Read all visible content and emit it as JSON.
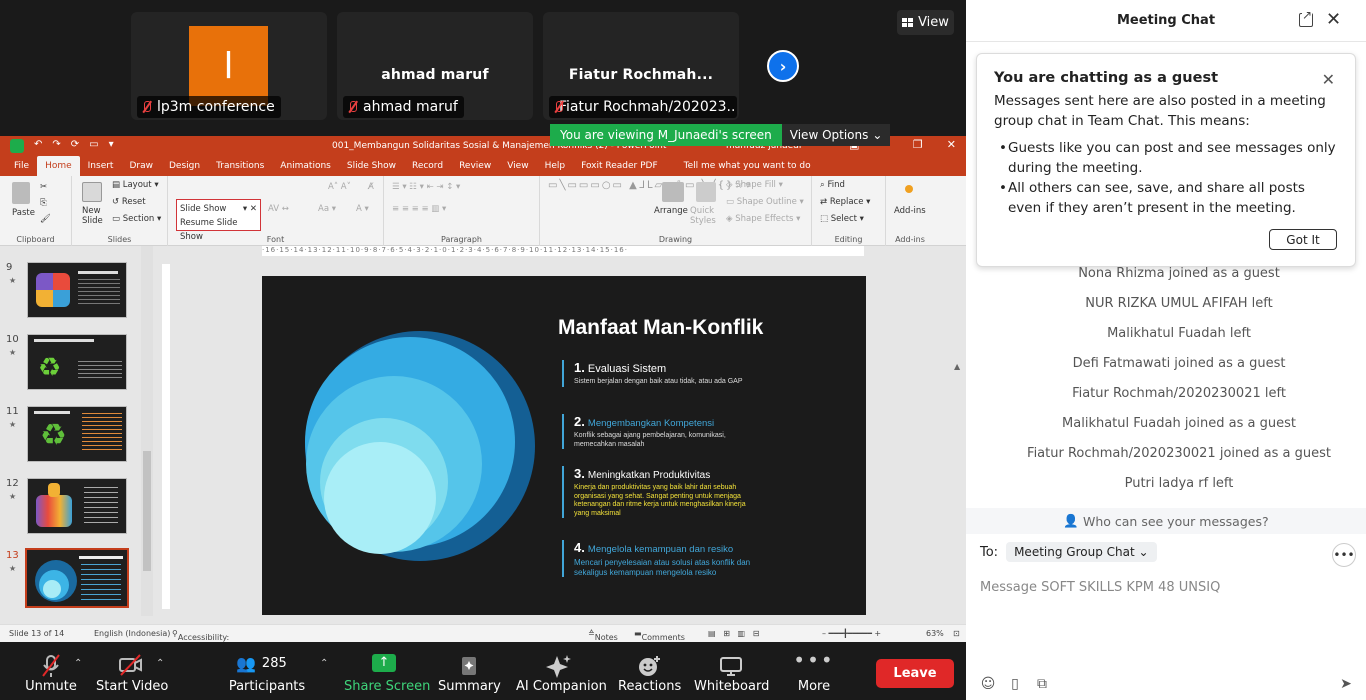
{
  "zoom": {
    "view_label": "View",
    "participants_tiles": [
      {
        "avatar_letter": "l",
        "display_name": "",
        "label": "lp3m conference"
      },
      {
        "avatar_letter": "",
        "display_name": "ahmad maruf",
        "label": "ahmad maruf"
      },
      {
        "avatar_letter": "",
        "display_name": "Fiatur Rochmah...",
        "label": "Fiatur Rochmah/202023..."
      }
    ],
    "viewing_banner": "You are viewing M_Junaedi's screen",
    "view_options": "View Options"
  },
  "ppt": {
    "window_title": "001_Membangun Solidaritas Sosial & Manajemen Konfliks (2)  -  PowerPoint",
    "user_name": "mahfudz junaedi",
    "tabs": [
      "File",
      "Home",
      "Insert",
      "Draw",
      "Design",
      "Transitions",
      "Animations",
      "Slide Show",
      "Record",
      "Review",
      "View",
      "Help",
      "Foxit Reader PDF"
    ],
    "active_tab": "Home",
    "tell_me": "Tell me what you want to do",
    "ribbon": {
      "clipboard": "Clipboard",
      "paste": "Paste",
      "new_slide": "New Slide",
      "layout": "Layout",
      "reset": "Reset",
      "section": "Section",
      "slides": "Slides",
      "slide_show_box": "Slide Show",
      "resume": "Resume Slide Show",
      "font": "Font",
      "paragraph": "Paragraph",
      "arrange": "Arrange",
      "quick_styles": "Quick Styles",
      "shape_fill": "Shape Fill",
      "shape_outline": "Shape Outline",
      "shape_effects": "Shape Effects",
      "drawing": "Drawing",
      "find": "Find",
      "replace": "Replace",
      "select": "Select",
      "editing": "Editing",
      "addins": "Add-ins",
      "addins_group": "Add-ins"
    },
    "thumbnails": [
      {
        "num": "9",
        "star": "★",
        "selected": false
      },
      {
        "num": "10",
        "star": "★",
        "selected": false
      },
      {
        "num": "11",
        "star": "★",
        "selected": false
      },
      {
        "num": "12",
        "star": "★",
        "selected": false
      },
      {
        "num": "13",
        "star": "★",
        "selected": true
      }
    ],
    "slide": {
      "title": "Manfaat Man-Konflik",
      "items": [
        {
          "n": "1.",
          "heading": "Evaluasi Sistem",
          "desc": "Sistem berjalan dengan baik atau tidak, atau ada GAP",
          "desc_color": "#dddddd"
        },
        {
          "n": "2.",
          "heading": "Mengembangkan Kompetensi",
          "desc": "Konflik sebagai ajang pembelajaran, komunikasi, memecahkan masalah",
          "desc_color": "#dddddd"
        },
        {
          "n": "3.",
          "heading": "Meningkatkan Produktivitas",
          "desc": "Kinerja dan produktivitas yang baik lahir dari sebuah organisasi yang sehat. Sangat penting untuk menjaga ketenangan dan ritme kerja untuk menghasilkan kinerja yang maksimal",
          "desc_color": "#f2e13a"
        },
        {
          "n": "4.",
          "heading": "Mengelola kemampuan dan resiko",
          "desc": "Mencari penyelesaian atau solusi atas konflik dan sekaligus kemampuan mengelola resiko",
          "desc_color": "#41a6d8"
        }
      ]
    },
    "status": {
      "slide_of": "Slide 13 of 14",
      "language": "English (Indonesia)",
      "accessibility": "Accessibility: Investigate",
      "notes": "Notes",
      "comments": "Comments",
      "zoom": "63%"
    }
  },
  "toolbar": {
    "unmute": "Unmute",
    "start_video": "Start Video",
    "participants": "Participants",
    "participants_count": "285",
    "share_screen": "Share Screen",
    "summary": "Summary",
    "ai_companion": "AI Companion",
    "reactions": "Reactions",
    "whiteboard": "Whiteboard",
    "more": "More",
    "leave": "Leave"
  },
  "chat": {
    "title": "Meeting Chat",
    "notice": {
      "heading": "You are chatting as a guest",
      "body": "Messages sent here are also posted in a meeting group chat in Team Chat. This means:",
      "bullets": [
        "Guests like you can post and see messages only during the meeting.",
        "All others can see, save, and share all posts even if they aren’t present in the meeting."
      ],
      "got_it": "Got It"
    },
    "system_messages": [
      "Nona Rhizma joined as a guest",
      "NUR RIZKA UMUL AFIFAH left",
      "Malikhatul Fuadah left",
      "Defi Fatmawati joined as a guest",
      "Fiatur Rochmah/2020230021 left",
      "Malikhatul Fuadah joined as a guest",
      "Fiatur Rochmah/2020230021 joined as a guest",
      "Putri ladya rf left"
    ],
    "who_can_see": "Who can see your messages?",
    "to_label": "To:",
    "to_value": "Meeting Group Chat",
    "input_placeholder": "Message SOFT SKILLS KPM 48 UNSIQ"
  },
  "colors": {
    "ppt_accent": "#c43e1c",
    "zoom_blue": "#0e71eb",
    "zoom_green": "#1dac4b",
    "leave_red": "#e02828"
  }
}
